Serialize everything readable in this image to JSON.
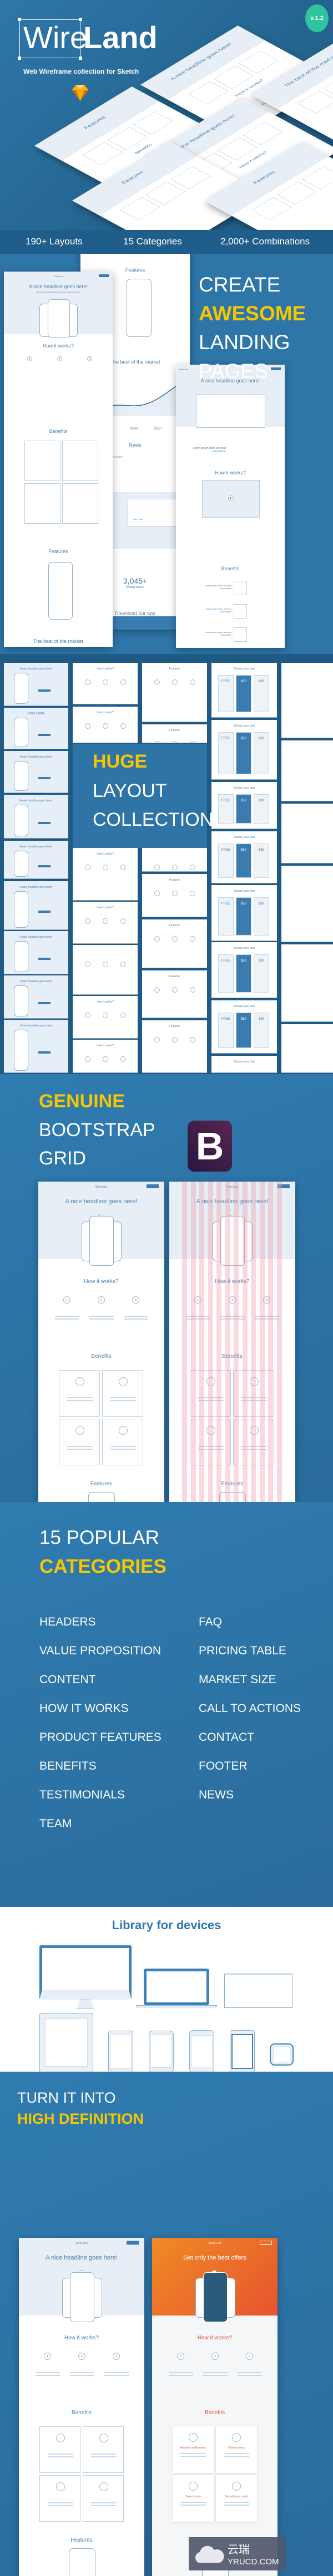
{
  "colors": {
    "brand_blue": "#2e75a8",
    "dark_blue": "#1f5d8a",
    "accent_yellow": "#f6c700",
    "badge_green": "#2ec4a0",
    "bootstrap_purple": "#563d7c",
    "hd_orange": "#ef7a24",
    "grid_pink": "#f3a7b6"
  },
  "hero": {
    "logo_left": "Wire",
    "logo_right": "Land",
    "subtitle": "Web Wireframe collection for Sketch",
    "sketch_icon": "sketch-diamond-icon",
    "version": "v.1.2",
    "iso_pages": [
      {
        "headline": "A nice headline goes here!",
        "section": "How it works?",
        "footer": "Features"
      },
      {
        "headline": "Features",
        "section": "Benefits",
        "footer": ""
      },
      {
        "headline": "A nice headline goes here!",
        "section": "How it works?",
        "footer": "Features"
      },
      {
        "headline": "The best of the market",
        "section": "",
        "footer": ""
      },
      {
        "headline": "Features",
        "section": "",
        "footer": ""
      },
      {
        "headline": "Features",
        "section": "",
        "footer": ""
      }
    ]
  },
  "stats": [
    "190+ Layouts",
    "15 Categories",
    "2,000+  Combinations"
  ],
  "landing": {
    "heading": [
      "CREATE",
      "AWESOME",
      "LANDING",
      "PAGES"
    ],
    "left_page": {
      "logo": "WireLand",
      "button": "BUTTON",
      "headline": "A nice headline goes here!",
      "sub": "Here goes a brief explanation about your awesome product.",
      "how": "How it works?",
      "steps": [
        "1",
        "2",
        "3"
      ],
      "step_labels": [
        "Step #1",
        "Step #2",
        "Step #3"
      ],
      "benefits": "Benefits",
      "features": "Features",
      "market": "The best of the market"
    },
    "center_page": {
      "features": "Features",
      "market": "The best of the market",
      "stats": [
        "580+",
        "831+"
      ],
      "news": "News",
      "news_sources": [
        "The New York Times",
        "Mashable"
      ],
      "testimonial_name": "John Doe",
      "users_count": "3,045+",
      "users_label": "Active users",
      "download": "Download our app",
      "store_buttons": [
        "App Store",
        "Google Play"
      ],
      "footer_logo": "WireLand"
    },
    "right_page": {
      "logo": "WireLand",
      "button": "BUTTON",
      "headline": "A nice headline goes here!",
      "intro": "Lorem ipsum dolor sit amet consectetur",
      "how": "How it works?",
      "benefits": "Benefits",
      "benefit_rows": [
        "Lorem ipsum dolor sit amet consectetur",
        "Lorem ipsum dolor sit amet consectetur",
        "Lorem ipsum dolor sit amet consectetur"
      ]
    }
  },
  "layouts": {
    "heading": [
      "HUGE",
      "LAYOUT",
      "COLLECTION"
    ],
    "columns": [
      [
        "A nice headline goes here!",
        "GOES HERE!",
        "A nice headline goes here!",
        "A nice headline goes here!",
        "A nice headline goes here!",
        "A nice headline goes here!",
        "A nice headline goes here!",
        "A nice headline goes here!",
        "A nice headline goes here"
      ],
      [
        "How it works?",
        "How it works?",
        "How it works?",
        "How it works?",
        "",
        "How it works?",
        "How it works?"
      ],
      [
        "Features",
        "Features",
        "",
        "Features",
        "Features",
        "Features",
        "Features"
      ],
      [
        "Choose your plan",
        "Choose your plan",
        "Choose your plan",
        "Choose your plan",
        "Choose your plan",
        "Choose your plan",
        "Choose your plan",
        "Choose your plan"
      ]
    ],
    "plan_prices": [
      "FREE",
      "$50",
      "$99"
    ]
  },
  "bootstrap": {
    "heading": [
      "GENUINE",
      "BOOTSTRAP",
      "GRID"
    ],
    "icon_letter": "B",
    "mockup": {
      "logo": "WireLand",
      "button": "BUTTON",
      "headline": "A nice headline goes here!",
      "how": "How it works?",
      "steps": [
        "1",
        "2",
        "3"
      ],
      "benefits": "Benefits",
      "features": "Features"
    }
  },
  "categories": {
    "heading": [
      "15 POPULAR",
      "CATEGORIES"
    ],
    "left": [
      "HEADERS",
      "VALUE PROPOSITION",
      "CONTENT",
      "HOW IT WORKS",
      "PRODUCT FEATURES",
      "BENEFITS",
      "TESTIMONIALS",
      "TEAM"
    ],
    "right": [
      "FAQ",
      "PRICING TABLE",
      "MARKET SIZE",
      "CALL TO ACTIONS",
      "CONTACT",
      "FOOTER",
      "NEWS"
    ]
  },
  "devices": {
    "title": "Library for devices"
  },
  "hd": {
    "heading": [
      "TURN IT INTO",
      "HIGH DEFINITION"
    ],
    "wire": {
      "logo": "WireLand",
      "button": "BUTTON",
      "headline": "A nice headline goes here!",
      "how": "How it works?",
      "steps": [
        "1",
        "2",
        "3"
      ],
      "benefits": "Benefits",
      "features": "Features"
    },
    "color": {
      "logo": "AdOFFER",
      "button": "BUTTON",
      "headline": "Get only the best offers",
      "how": "How it works?",
      "steps": [
        "1",
        "2",
        "3"
      ],
      "benefits": "Benefits",
      "benefit_cards": [
        "Receive notifications",
        "Follow stores",
        "Save money",
        "Buy what you want"
      ]
    }
  },
  "watermark": {
    "cn": "云瑞",
    "en": "YRUCD.COM"
  }
}
